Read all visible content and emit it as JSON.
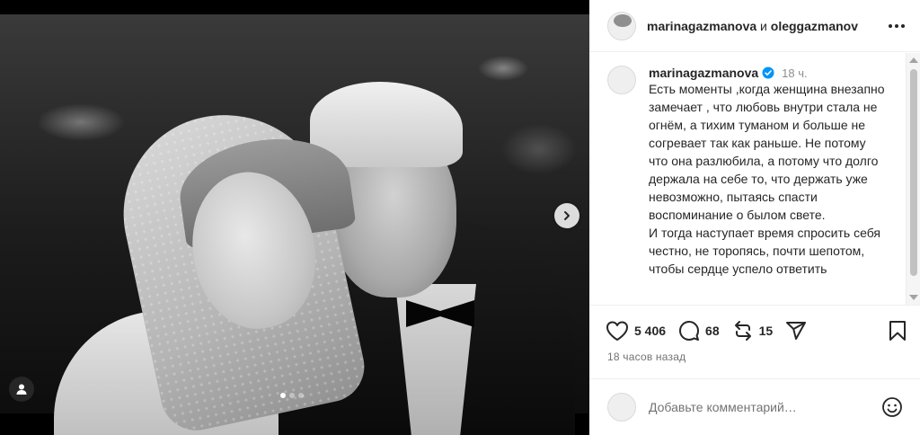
{
  "post": {
    "header": {
      "user1": "marinagazmanova",
      "and": " и ",
      "user2": "oleggazmanov"
    },
    "caption": {
      "username": "marinagazmanova",
      "time": "18 ч.",
      "text": "Есть моменты ,когда женщина внезапно замечает , что любовь внутри стала не огнём, а тихим туманом и больше не согревает так как раньше. Не потому что она разлюбила, а потому что долго держала на себе то, что держать уже невозможно, пытаясь спасти воспоминание о былом свете.\nИ тогда наступает время спросить себя честно, не торопясь, почти шепотом, чтобы сердце успело ответить"
    },
    "stats": {
      "likes": "5 406",
      "comments": "68",
      "reposts": "15"
    },
    "time_ago": "18 часов назад",
    "comment_placeholder": "Добавьте комментарий…"
  },
  "media": {
    "carousel_total": 3,
    "carousel_active": 1
  },
  "icons": {
    "like": "heart-icon",
    "comment": "comment-bubble-icon",
    "repost": "repost-icon",
    "share": "paper-plane-icon",
    "save": "bookmark-icon",
    "more": "more-horizontal-icon",
    "verified": "verified-badge-icon",
    "next": "chevron-right-icon",
    "tag": "user-tag-icon",
    "emoji": "emoji-icon"
  },
  "colors": {
    "verified": "#0095f6",
    "text": "#262626",
    "muted": "#737373"
  }
}
